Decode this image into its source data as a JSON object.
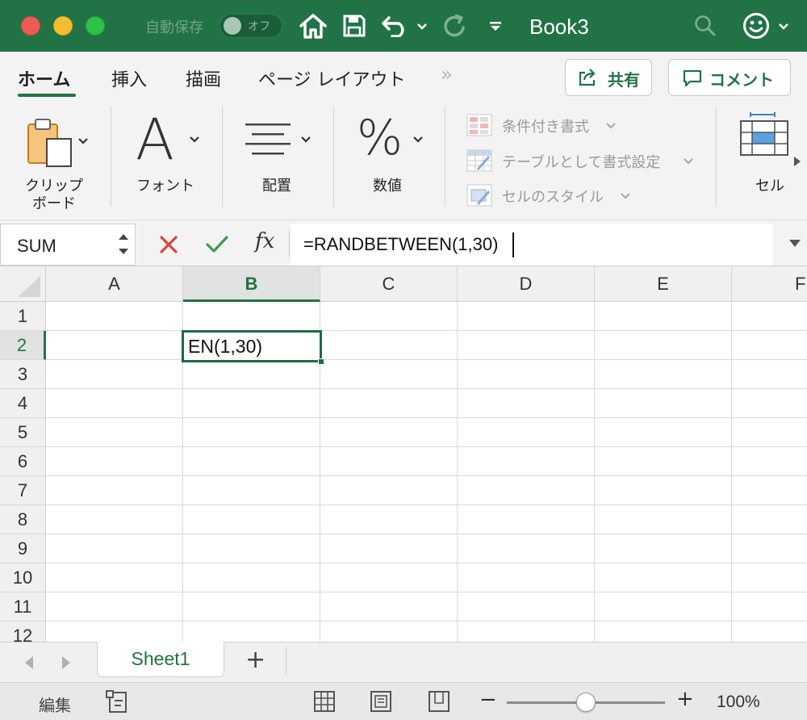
{
  "titlebar": {
    "autosave_label": "自動保存",
    "autosave_state": "オフ",
    "book_title": "Book3",
    "icons": [
      "home-icon",
      "save-icon",
      "undo-icon",
      "redo-icon",
      "customize-icon",
      "search-icon",
      "feedback-smiley-icon"
    ],
    "colors": {
      "bar": "#217346",
      "close": "#ee5b55",
      "minimize": "#f5bd31",
      "zoom": "#2ec04b"
    }
  },
  "tabs": {
    "items": [
      "ホーム",
      "挿入",
      "描画",
      "ページ レイアウト"
    ],
    "active": "ホーム",
    "more": "»",
    "share_label": "共有",
    "comment_label": "コメント"
  },
  "ribbon": {
    "clipboard_label_line1": "クリップ",
    "clipboard_label_line2": "ボード",
    "font_label": "フォント",
    "font_glyph": "A",
    "alignment_label": "配置",
    "number_label": "数値",
    "number_glyph": "%",
    "conditional_format": "条件付き書式",
    "format_as_table": "テーブルとして書式設定",
    "cell_styles": "セルのスタイル",
    "cells_label": "セル"
  },
  "formula_bar": {
    "name_box": "SUM",
    "cancel_icon": "✕",
    "enter_icon": "✓",
    "fx_label": "fx",
    "formula": "=RANDBETWEEN(1,30)"
  },
  "grid": {
    "columns": [
      "A",
      "B",
      "C",
      "D",
      "E",
      "F"
    ],
    "rows": [
      "1",
      "2",
      "3",
      "4",
      "5",
      "6",
      "7",
      "8",
      "9",
      "10",
      "11",
      "12"
    ],
    "active_column": "B",
    "active_row": "2",
    "active_cell_text": "EN(1,30)"
  },
  "sheets": {
    "tabs": [
      "Sheet1"
    ],
    "active": "Sheet1",
    "add_label": "+"
  },
  "statusbar": {
    "mode": "編集",
    "zoom_minus": "−",
    "zoom_plus": "+",
    "zoom": "100%",
    "zoom_fraction": 0.5
  }
}
